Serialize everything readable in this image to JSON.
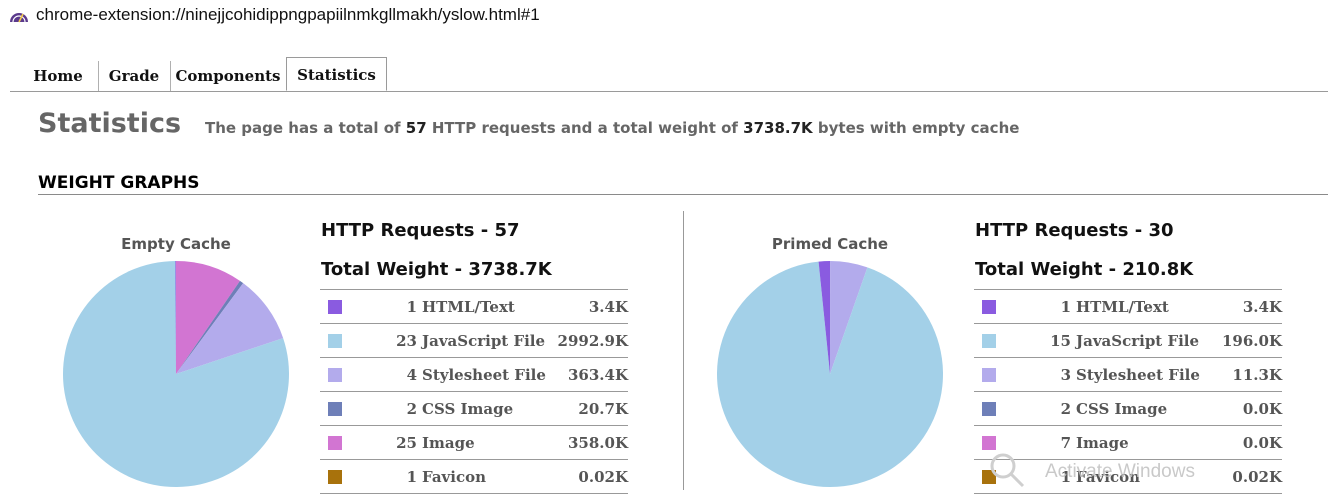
{
  "address_bar": {
    "url": "chrome-extension://ninejjcohidippngpapiilnmkgllmakh/yslow.html#1"
  },
  "tabs": [
    {
      "label": "Home"
    },
    {
      "label": "Grade"
    },
    {
      "label": "Components"
    },
    {
      "label": "Statistics",
      "active": true
    }
  ],
  "page": {
    "title": "Statistics",
    "summary_pre": "The page has a total of ",
    "summary_requests": "57",
    "summary_mid": " HTTP requests and a total weight of ",
    "summary_weight": "3738.7K",
    "summary_post": " bytes with empty cache",
    "section_title": "WEIGHT GRAPHS"
  },
  "colors": {
    "html_text": "#8a5be0",
    "javascript_file": "#a3d0e8",
    "stylesheet_file": "#b3abec",
    "css_image": "#6e7fb8",
    "image": "#d275d2",
    "favicon": "#a8720c"
  },
  "empty_cache": {
    "pie_label": "Empty Cache",
    "requests_title": "HTTP Requests - 57",
    "weight_title": "Total Weight - 3738.7K",
    "rows": [
      {
        "count": "1",
        "type": "HTML/Text",
        "size": "3.4K",
        "color_key": "html_text"
      },
      {
        "count": "23",
        "type": "JavaScript File",
        "size": "2992.9K",
        "color_key": "javascript_file"
      },
      {
        "count": "4",
        "type": "Stylesheet File",
        "size": "363.4K",
        "color_key": "stylesheet_file"
      },
      {
        "count": "2",
        "type": "CSS Image",
        "size": "20.7K",
        "color_key": "css_image"
      },
      {
        "count": "25",
        "type": "Image",
        "size": "358.0K",
        "color_key": "image"
      },
      {
        "count": "1",
        "type": "Favicon",
        "size": "0.02K",
        "color_key": "favicon"
      }
    ]
  },
  "primed_cache": {
    "pie_label": "Primed Cache",
    "requests_title": "HTTP Requests - 30",
    "weight_title": "Total Weight - 210.8K",
    "rows": [
      {
        "count": "1",
        "type": "HTML/Text",
        "size": "3.4K",
        "color_key": "html_text"
      },
      {
        "count": "15",
        "type": "JavaScript File",
        "size": "196.0K",
        "color_key": "javascript_file"
      },
      {
        "count": "3",
        "type": "Stylesheet File",
        "size": "11.3K",
        "color_key": "stylesheet_file"
      },
      {
        "count": "2",
        "type": "CSS Image",
        "size": "0.0K",
        "color_key": "css_image"
      },
      {
        "count": "7",
        "type": "Image",
        "size": "0.0K",
        "color_key": "image"
      },
      {
        "count": "1",
        "type": "Favicon",
        "size": "0.02K",
        "color_key": "favicon"
      }
    ]
  },
  "chart_data": [
    {
      "type": "pie",
      "title": "Empty Cache",
      "categories": [
        "HTML/Text",
        "JavaScript File",
        "Stylesheet File",
        "CSS Image",
        "Image",
        "Favicon"
      ],
      "values": [
        3.4,
        2992.9,
        363.4,
        20.7,
        358.0,
        0.02
      ]
    },
    {
      "type": "pie",
      "title": "Primed Cache",
      "categories": [
        "HTML/Text",
        "JavaScript File",
        "Stylesheet File",
        "CSS Image",
        "Image",
        "Favicon"
      ],
      "values": [
        3.4,
        196.0,
        11.3,
        0.0,
        0.0,
        0.02
      ]
    }
  ],
  "watermark": {
    "text": "Activate Windows"
  }
}
